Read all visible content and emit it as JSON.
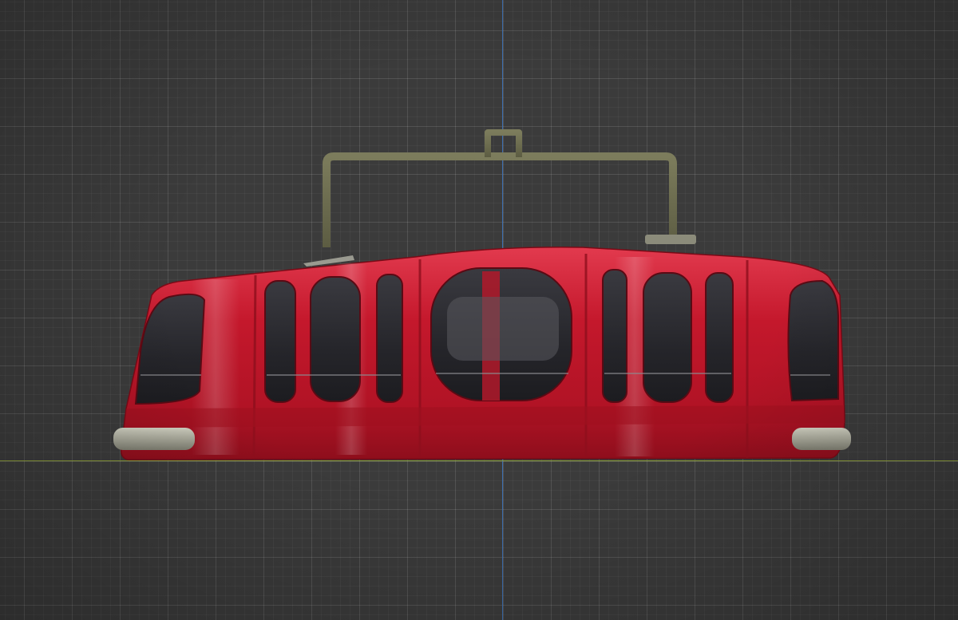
{
  "viewport": {
    "background_color": "#3b3b3b",
    "grid_color": "#4a4a4a",
    "axis_z_color": "#3d6fb0",
    "axis_x_color": "#8a9a3a"
  },
  "model": {
    "body_color": "#c0182a",
    "body_highlight": "#e8364a",
    "hanger_color": "#6e6e4e",
    "bumper_color": "#a9a99a",
    "window_color": "#2a2a2e"
  }
}
